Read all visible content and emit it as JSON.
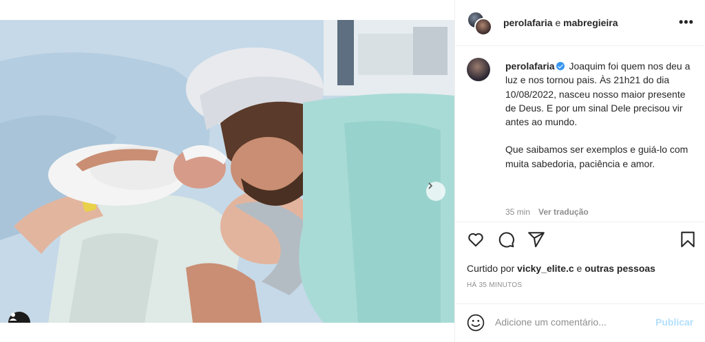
{
  "post": {
    "photo_alt": "",
    "carousel": {
      "slides": 4,
      "active": 1
    }
  },
  "header": {
    "user1": "perolafaria",
    "connector": " e ",
    "user2": "mabregieira",
    "more_label": "•••"
  },
  "caption": {
    "username": "perolafaria",
    "verified": true,
    "paragraph1": "Joaquim foi quem nos deu a luz e nos tornou pais. Às 21h21 do dia 10/08/2022, nasceu nosso maior presente de Deus. E por um sinal Dele precisou vir antes ao mundo.",
    "paragraph2": "Que saibamos ser exemplos e guiá-lo com muita sabedoria, paciência e amor.",
    "age": "35 min",
    "translate": "Ver tradução"
  },
  "actions": {
    "like": "heart-icon",
    "comment": "comment-icon",
    "share": "share-icon",
    "save": "bookmark-icon"
  },
  "likes": {
    "prefix": "Curtido por ",
    "user": "vicky_elite.c",
    "middle": " e ",
    "others": "outras pessoas"
  },
  "timestamp": "HÁ 35 MINUTOS",
  "comment": {
    "placeholder": "Adicione um comentário...",
    "publish_label": "Publicar"
  },
  "colors": {
    "verified": "#3897f0",
    "publish_disabled": "#b2dffc",
    "muted": "#8e8e8e",
    "text": "#262626"
  }
}
